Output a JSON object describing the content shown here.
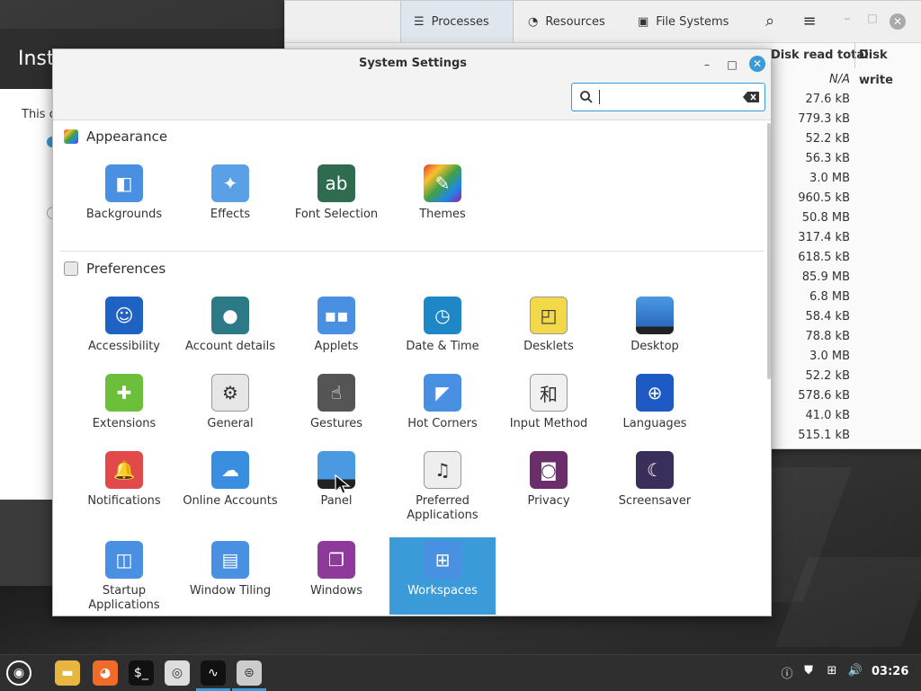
{
  "installer": {
    "title": "Inst",
    "text": "This c"
  },
  "sysmon": {
    "tabs": [
      {
        "label": "Processes",
        "icon": "list-icon"
      },
      {
        "label": "Resources",
        "icon": "gauge-icon"
      },
      {
        "label": "File Systems",
        "icon": "disk-icon"
      }
    ],
    "columns": [
      "Disk read total",
      "Disk write"
    ],
    "disk_read_values": [
      "N/A",
      "27.6 kB",
      "779.3 kB",
      "52.2 kB",
      "56.3 kB",
      "3.0 MB",
      "960.5 kB",
      "50.8 MB",
      "317.4 kB",
      "618.5 kB",
      "85.9 MB",
      "6.8 MB",
      "58.4 kB",
      "78.8 kB",
      "3.0 MB",
      "52.2 kB",
      "578.6 kB",
      "41.0 kB",
      "515.1 kB"
    ]
  },
  "settings": {
    "title": "System Settings",
    "search": {
      "value": "",
      "placeholder": ""
    },
    "sections": {
      "appearance": {
        "label": "Appearance",
        "items": [
          "Backgrounds",
          "Effects",
          "Font Selection",
          "Themes"
        ]
      },
      "preferences": {
        "label": "Preferences",
        "items": [
          "Accessibility",
          "Account details",
          "Applets",
          "Date & Time",
          "Desklets",
          "Desktop",
          "Extensions",
          "General",
          "Gestures",
          "Hot Corners",
          "Input Method",
          "Languages",
          "Notifications",
          "Online Accounts",
          "Panel",
          "Preferred Applications",
          "Privacy",
          "Screensaver",
          "Startup Applications",
          "Window Tiling",
          "Windows",
          "Workspaces"
        ]
      }
    },
    "selected_item": "Workspaces"
  },
  "taskbar": {
    "clock": "03:26",
    "apps": [
      "menu-icon",
      "files-icon",
      "firefox-icon",
      "terminal-icon",
      "disc-icon",
      "system-monitor-icon",
      "system-settings-icon"
    ]
  },
  "colors": {
    "accent": "#3b9bd8",
    "panel": "#2f2f2f"
  }
}
